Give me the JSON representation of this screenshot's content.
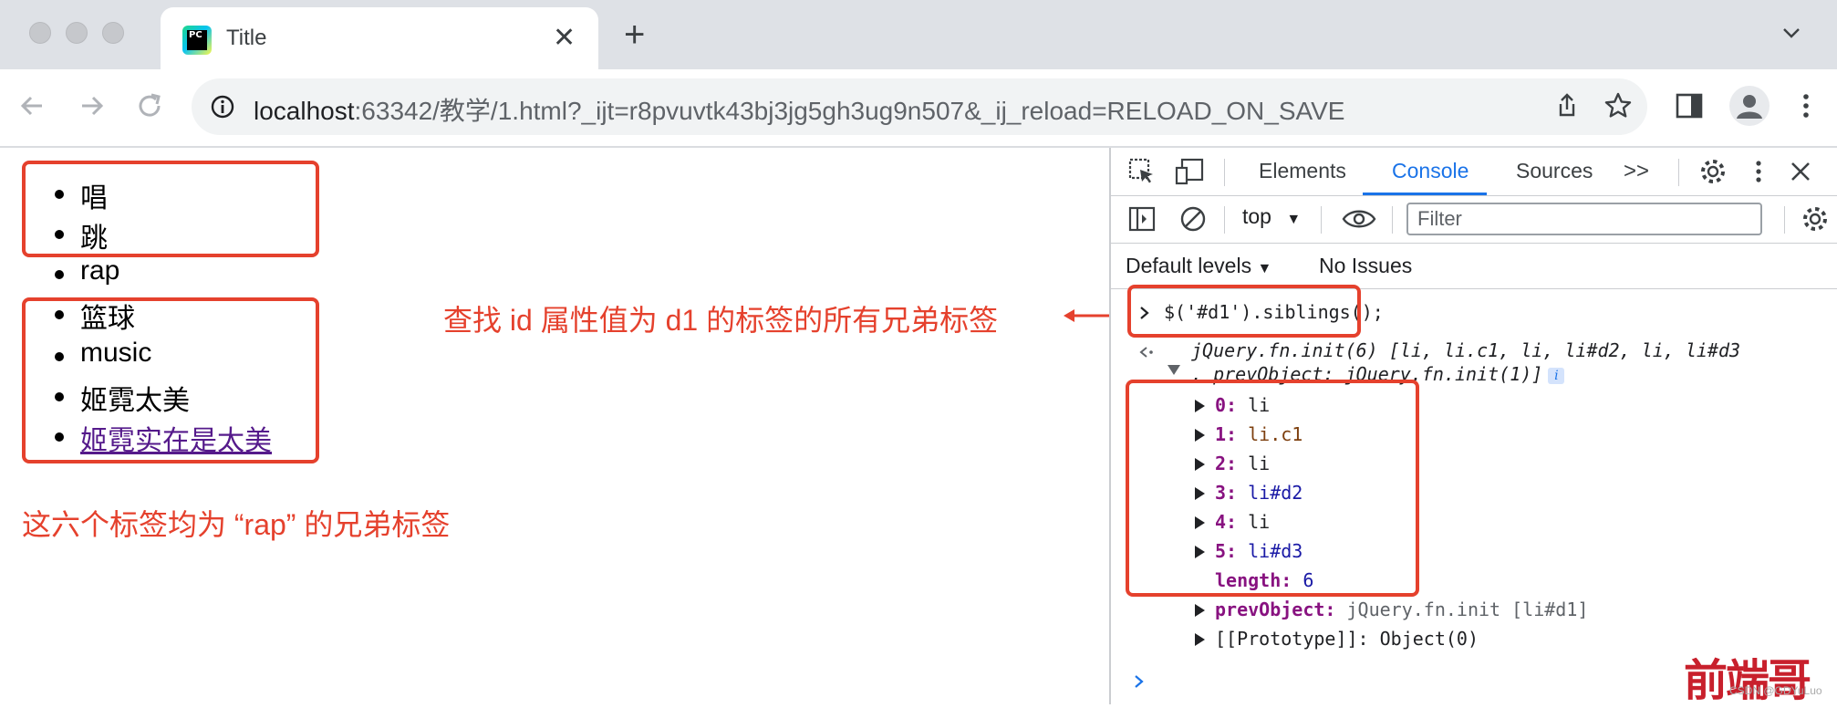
{
  "browser": {
    "tab_title": "Title",
    "tab_favicon_text": "PC",
    "url_host": "localhost",
    "url_rest": ":63342/教学/1.html?_ijt=r8pvuvtk43bj3jg5gh3ug9n507&_ij_reload=RELOAD_ON_SAVE"
  },
  "page": {
    "items": [
      {
        "text": "唱"
      },
      {
        "text": "跳"
      },
      {
        "text": "rap"
      },
      {
        "text": "篮球"
      },
      {
        "text": "music"
      },
      {
        "text": "姬霓太美"
      },
      {
        "text": "姬霓实在是太美",
        "link": true
      }
    ],
    "annotation_find": "查找 id 属性值为 d1 的标签的所有兄弟标签",
    "annotation_siblings": "这六个标签均为 “rap” 的兄弟标签",
    "annotation_color": "#e5412d"
  },
  "devtools": {
    "tabs": [
      "Elements",
      "Console",
      "Sources"
    ],
    "active_tab": "Console",
    "more_tabs": ">>",
    "context": "top",
    "filter_placeholder": "Filter",
    "default_levels": "Default levels",
    "issues": "No Issues",
    "console": {
      "input": "$('#d1').siblings();",
      "result_line1": "jQuery.fn.init(6) [li, li.c1, li, li#d2, li, li#d3",
      "result_line2": ", prevObject: jQuery.fn.init(1)]",
      "info_badge": "i",
      "entries": [
        {
          "key": "0",
          "val": "li"
        },
        {
          "key": "1",
          "val": "li.c1"
        },
        {
          "key": "2",
          "val": "li"
        },
        {
          "key": "3",
          "val": "li#d2"
        },
        {
          "key": "4",
          "val": "li"
        },
        {
          "key": "5",
          "val": "li#d3"
        }
      ],
      "length_key": "length",
      "length_val": "6",
      "prev_key": "prevObject",
      "prev_val": "jQuery.fn.init [li#d1]",
      "proto_key": "[[Prototype]]",
      "proto_val": "Object(0)"
    }
  },
  "watermark": "前端哥",
  "csdn_credit": "CSDN @GDYuLuo"
}
